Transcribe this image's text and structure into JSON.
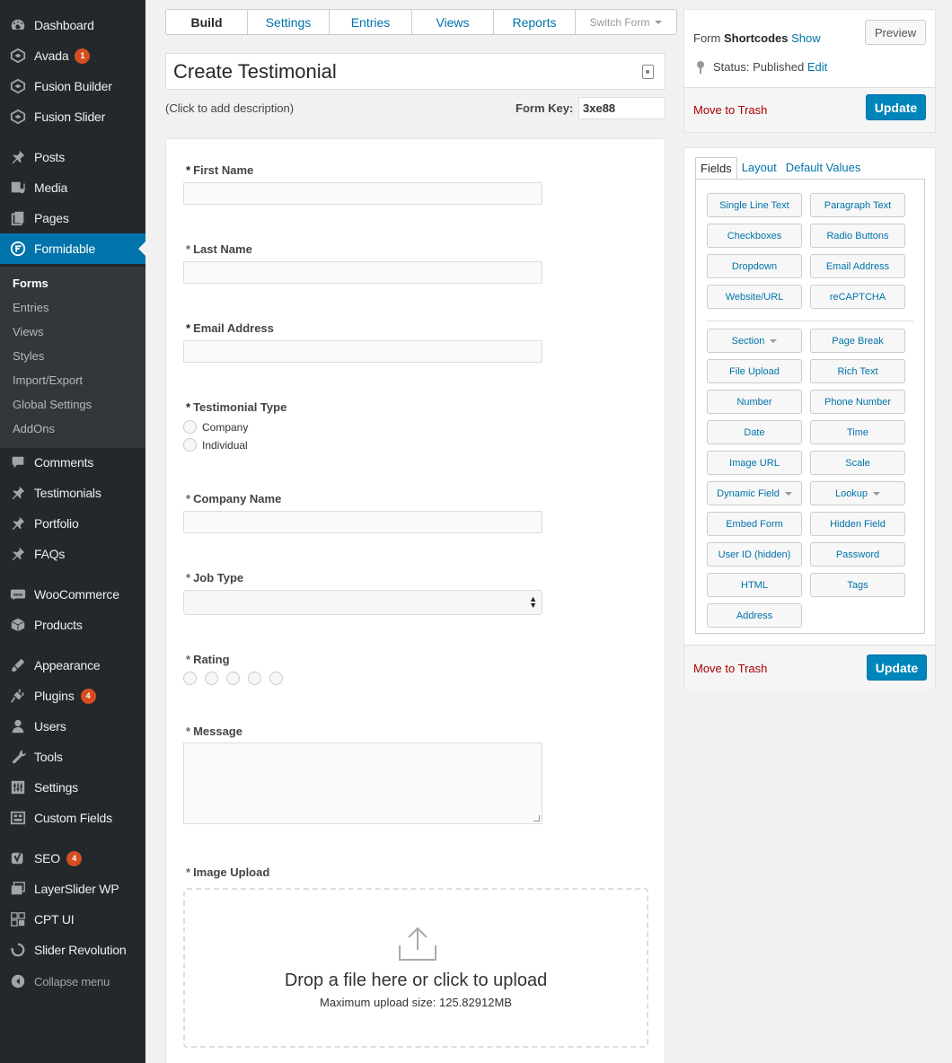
{
  "sidebar": {
    "items": [
      {
        "label": "Dashboard",
        "icon": "dashboard-icon"
      },
      {
        "label": "Avada",
        "icon": "avada-icon",
        "badge": "1"
      },
      {
        "label": "Fusion Builder",
        "icon": "fusion-builder-icon"
      },
      {
        "label": "Fusion Slider",
        "icon": "fusion-slider-icon"
      },
      {
        "label": "Posts",
        "icon": "pushpin-icon"
      },
      {
        "label": "Media",
        "icon": "media-icon"
      },
      {
        "label": "Pages",
        "icon": "pages-icon"
      },
      {
        "label": "Formidable",
        "icon": "formidable-icon"
      },
      {
        "label": "Comments",
        "icon": "comments-icon"
      },
      {
        "label": "Testimonials",
        "icon": "pushpin-icon"
      },
      {
        "label": "Portfolio",
        "icon": "pushpin-icon"
      },
      {
        "label": "FAQs",
        "icon": "pushpin-icon"
      },
      {
        "label": "WooCommerce",
        "icon": "woocommerce-icon"
      },
      {
        "label": "Products",
        "icon": "products-icon"
      },
      {
        "label": "Appearance",
        "icon": "appearance-icon"
      },
      {
        "label": "Plugins",
        "icon": "plugins-icon",
        "badge": "4"
      },
      {
        "label": "Users",
        "icon": "users-icon"
      },
      {
        "label": "Tools",
        "icon": "tools-icon"
      },
      {
        "label": "Settings",
        "icon": "settings-icon"
      },
      {
        "label": "Custom Fields",
        "icon": "custom-fields-icon"
      },
      {
        "label": "SEO",
        "icon": "seo-icon",
        "badge": "4"
      },
      {
        "label": "LayerSlider WP",
        "icon": "layerslider-icon"
      },
      {
        "label": "CPT UI",
        "icon": "cpt-ui-icon"
      },
      {
        "label": "Slider Revolution",
        "icon": "slider-revolution-icon"
      }
    ],
    "submenu": [
      "Forms",
      "Entries",
      "Views",
      "Styles",
      "Import/Export",
      "Global Settings",
      "AddOns"
    ],
    "collapse_label": "Collapse menu"
  },
  "tabs": {
    "build": "Build",
    "settings": "Settings",
    "entries": "Entries",
    "views": "Views",
    "reports": "Reports",
    "switch_form": "Switch Form"
  },
  "form_title": "Create Testimonial",
  "description_prompt": "(Click to add description)",
  "form_key": {
    "label": "Form Key:",
    "value": "3xe88"
  },
  "fields": {
    "first_name": "First Name",
    "last_name": "Last Name",
    "email": "Email Address",
    "testimonial_type": "Testimonial Type",
    "testimonial_options": [
      "Company",
      "Individual"
    ],
    "company_name": "Company Name",
    "job_type": "Job Type",
    "rating": "Rating",
    "message": "Message",
    "image_upload": "Image Upload",
    "required_mark": "*"
  },
  "upload": {
    "title": "Drop a file here or click to upload",
    "subtitle": "Maximum upload size: 125.82912MB"
  },
  "publish": {
    "shortcodes_prefix": "Form",
    "shortcodes_bold": "Shortcodes",
    "shortcodes_link": "Show",
    "status_text": "Status: Published",
    "status_link": "Edit",
    "preview": "Preview",
    "trash": "Move to Trash",
    "update": "Update"
  },
  "field_panel": {
    "tabs": [
      "Fields",
      "Layout",
      "Default Values"
    ],
    "buttons": [
      "Single Line Text",
      "Paragraph Text",
      "Checkboxes",
      "Radio Buttons",
      "Dropdown",
      "Email Address",
      "Website/URL",
      "reCAPTCHA",
      "Section",
      "Page Break",
      "File Upload",
      "Rich Text",
      "Number",
      "Phone Number",
      "Date",
      "Time",
      "Image URL",
      "Scale",
      "Dynamic Field",
      "Lookup",
      "Embed Form",
      "Hidden Field",
      "User ID (hidden)",
      "Password",
      "HTML",
      "Tags",
      "Address"
    ],
    "trash": "Move to Trash",
    "update": "Update"
  },
  "colors": {
    "sidebar": "#23282d",
    "accent": "#0073aa",
    "update_button": "#0085ba",
    "badge": "#d54e21",
    "trash": "#aa0000"
  }
}
